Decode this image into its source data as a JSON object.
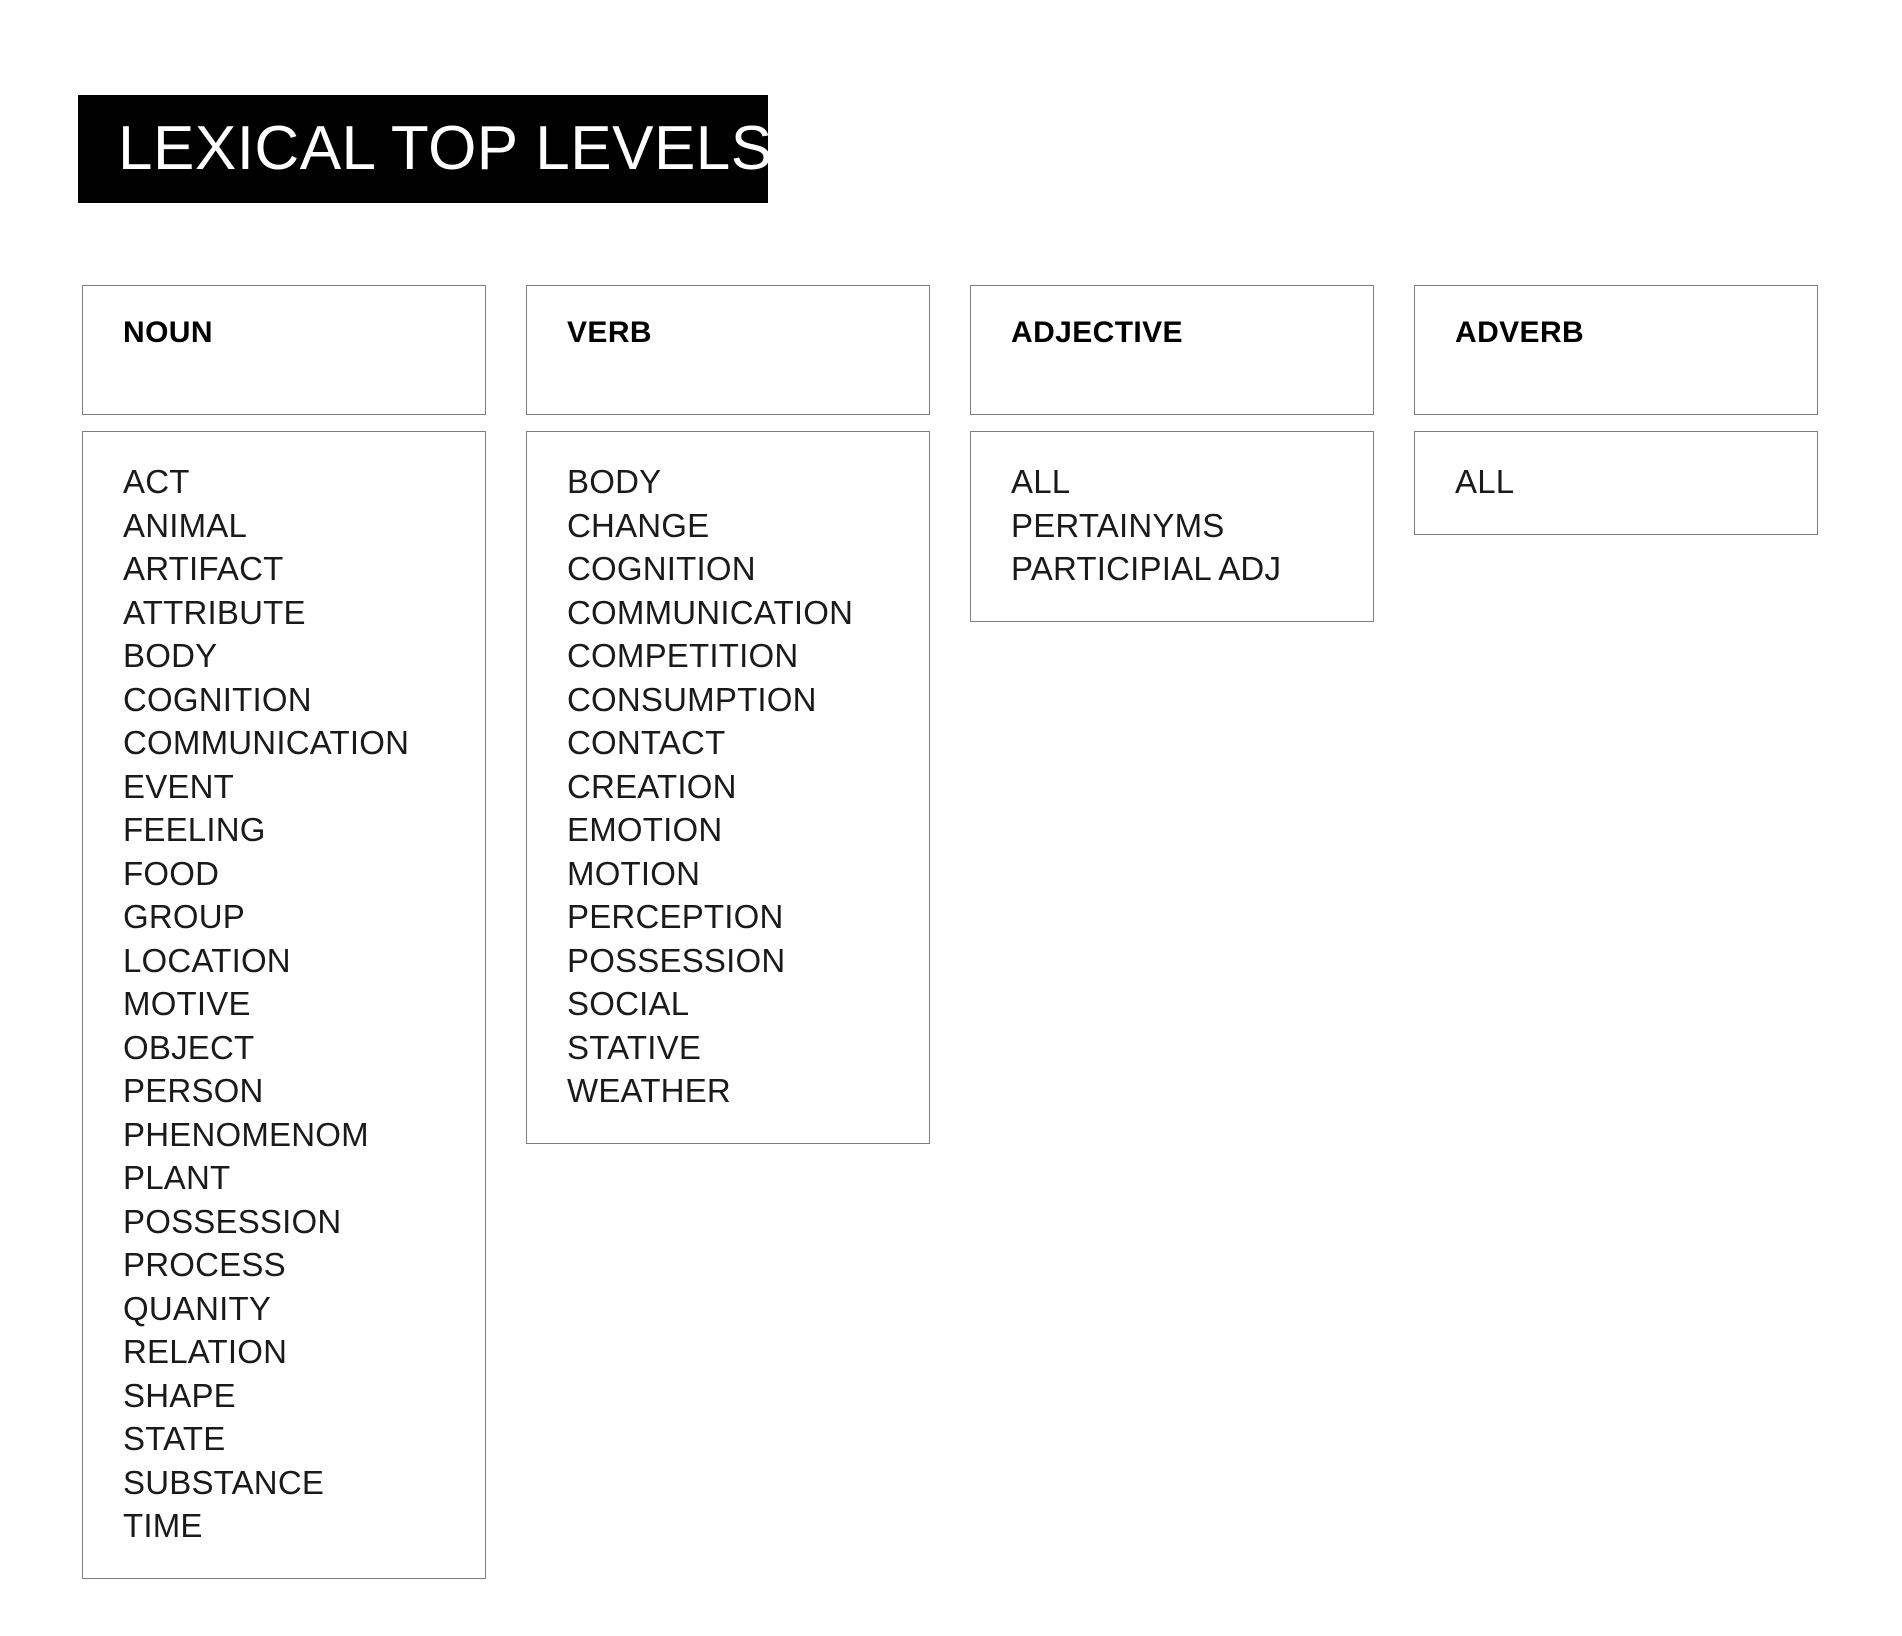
{
  "page": {
    "title": "LEXICAL TOP LEVELS",
    "background_color": "#ffffff",
    "banner_color": "#000000",
    "banner_text_color": "#ffffff",
    "border_color": "#7d7d7d",
    "text_color": "#1a1a1a"
  },
  "columns": [
    {
      "header": "NOUN",
      "items": [
        "ACT",
        "ANIMAL",
        "ARTIFACT",
        "ATTRIBUTE",
        "BODY",
        "COGNITION",
        "COMMUNICATION",
        "EVENT",
        "FEELING",
        "FOOD",
        "GROUP",
        "LOCATION",
        "MOTIVE",
        "OBJECT",
        "PERSON",
        "PHENOMENOM",
        "PLANT",
        "POSSESSION",
        "PROCESS",
        "QUANITY",
        "RELATION",
        "SHAPE",
        "STATE",
        "SUBSTANCE",
        "TIME"
      ]
    },
    {
      "header": "VERB",
      "items": [
        "BODY",
        "CHANGE",
        "COGNITION",
        "COMMUNICATION",
        "COMPETITION",
        "CONSUMPTION",
        "CONTACT",
        "CREATION",
        "EMOTION",
        "MOTION",
        "PERCEPTION",
        "POSSESSION",
        "SOCIAL",
        "STATIVE",
        "WEATHER"
      ]
    },
    {
      "header": "ADJECTIVE",
      "items": [
        "ALL",
        "PERTAINYMS",
        "PARTICIPIAL ADJ"
      ]
    },
    {
      "header": "ADVERB",
      "items": [
        "ALL"
      ]
    }
  ]
}
